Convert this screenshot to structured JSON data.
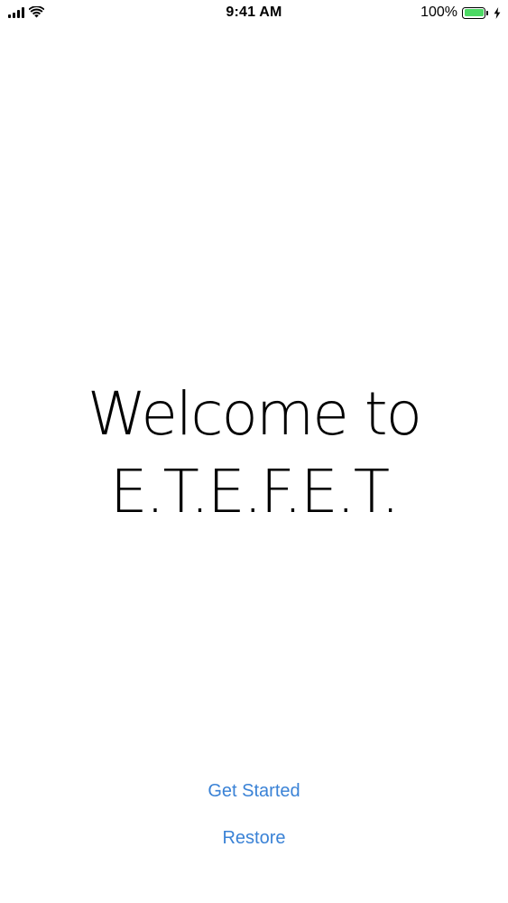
{
  "status_bar": {
    "time": "9:41 AM",
    "battery_percent": "100%",
    "battery_level": 1.0,
    "battery_color": "#4cd964",
    "charging": true,
    "signal_strength": 4,
    "icons": [
      "signal-icon",
      "wifi-icon",
      "battery-icon",
      "charging-bolt-icon"
    ]
  },
  "welcome": {
    "line1": "Welcome to",
    "line2": "E.T.E.F.E.T."
  },
  "actions": {
    "get_started_label": "Get Started",
    "restore_label": "Restore",
    "link_color": "#3a82d6"
  }
}
